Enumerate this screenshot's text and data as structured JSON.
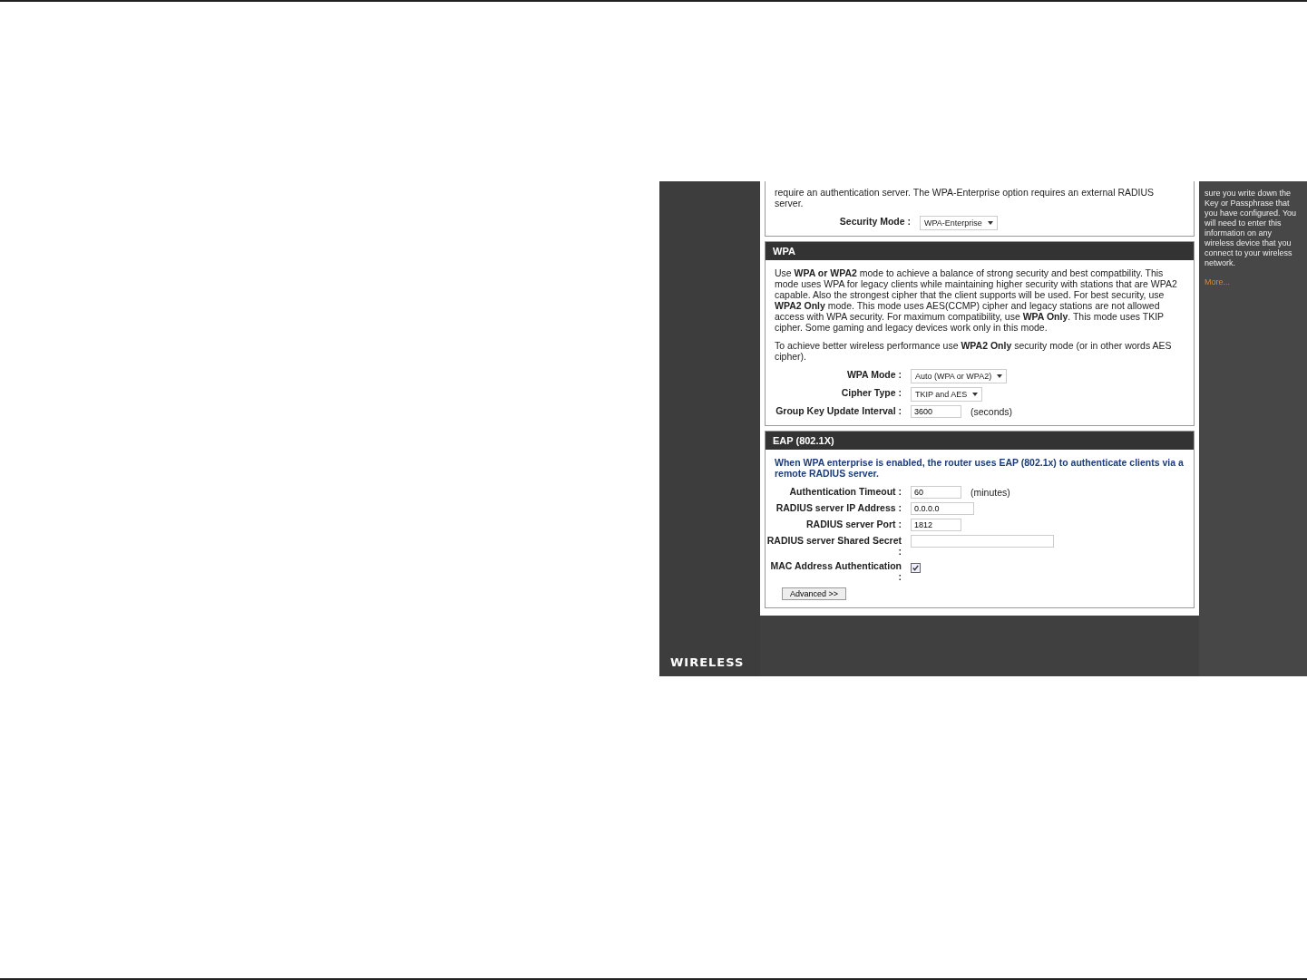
{
  "intro": {
    "text": "require an authentication server. The WPA-Enterprise option requires an external RADIUS server.",
    "fields": [
      {
        "label": "Security Mode :",
        "kind": "select",
        "value": "WPA-Enterprise"
      }
    ]
  },
  "sections": [
    {
      "title": "WPA",
      "paragraphs": [
        "Use **WPA or WPA2** mode to achieve a balance of strong security and best compatbility. This mode uses WPA for legacy clients while maintaining higher security with stations that are WPA2 capable. Also the strongest cipher that the client supports will be used. For best security, use **WPA2 Only** mode. This mode uses AES(CCMP) cipher and legacy stations are not allowed access with WPA security. For maximum compatibility, use **WPA Only**. This mode uses TKIP cipher. Some gaming and legacy devices work only in this mode.",
        "To achieve better wireless performance use **WPA2 Only** security mode (or in other words AES cipher)."
      ],
      "fields": [
        {
          "label": "WPA Mode :",
          "kind": "select",
          "value": "Auto (WPA or WPA2)"
        },
        {
          "label": "Cipher Type :",
          "kind": "select",
          "value": "TKIP and AES"
        },
        {
          "label": "Group Key Update Interval :",
          "kind": "text",
          "value": "3600",
          "suffix": "(seconds)"
        }
      ]
    },
    {
      "title": "EAP (802.1X)",
      "note": "When WPA enterprise is enabled, the router uses EAP (802.1x) to authenticate clients via a remote RADIUS server.",
      "fields": [
        {
          "label": "Authentication Timeout :",
          "kind": "text",
          "value": "60",
          "suffix": "(minutes)"
        },
        {
          "label": "RADIUS server IP Address :",
          "kind": "text",
          "value": "0.0.0.0"
        },
        {
          "label": "RADIUS server Port :",
          "kind": "text",
          "value": "1812"
        },
        {
          "label": "RADIUS server Shared Secret :",
          "kind": "wide_text"
        },
        {
          "label": "MAC Address Authentication :",
          "kind": "checkbox",
          "checked": true
        }
      ],
      "button": "Advanced >>"
    }
  ],
  "help": {
    "text": "sure you write down the Key or Passphrase that you have configured. You will need to enter this information on any wireless device that you connect to your wireless network.",
    "link": "More..."
  },
  "footer_label": "WIRELESS"
}
